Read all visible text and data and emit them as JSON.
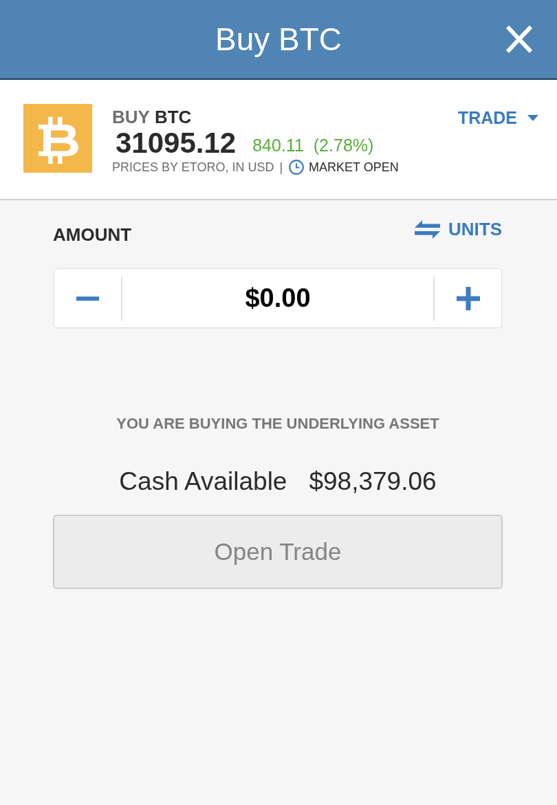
{
  "header": {
    "title": "Buy BTC"
  },
  "instrument": {
    "action": "BUY",
    "symbol": "BTC",
    "price": "31095.12",
    "change": "840.11",
    "change_percent": "(2.78%)",
    "rising": true,
    "source": "PRICES BY ETORO, IN USD",
    "separator": "|",
    "market_status": "MARKET OPEN"
  },
  "trade_menu": {
    "label": "TRADE",
    "expanded": false
  },
  "amount": {
    "label": "AMOUNT",
    "toggle_label": "UNITS",
    "value": "$0.00"
  },
  "notice": "YOU ARE BUYING THE UNDERLYING ASSET",
  "cash": {
    "label": "Cash Available",
    "value": "$98,379.06"
  },
  "submit": {
    "label": "Open Trade",
    "disabled": true
  }
}
